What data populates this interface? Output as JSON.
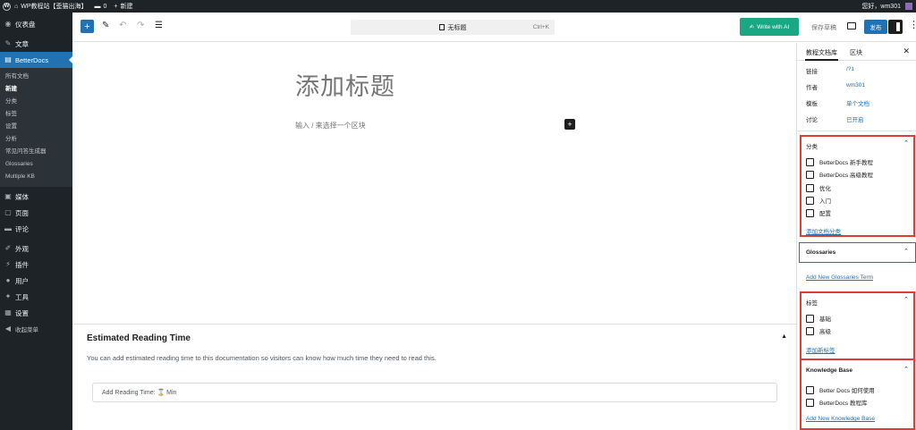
{
  "adminbar": {
    "site_name": "WP教程站【歪猫出海】",
    "comments_count": "0",
    "new_label": "新建",
    "greeting": "您好，wm301"
  },
  "sidebar": {
    "items": [
      {
        "label": "仪表盘",
        "icon": "dashboard-icon",
        "glyph": "◉"
      },
      {
        "label": "文章",
        "icon": "pin-icon",
        "glyph": "✎"
      },
      {
        "label": "BetterDocs",
        "icon": "docs-icon",
        "glyph": "▤"
      }
    ],
    "submenu": [
      "所有文档",
      "新建",
      "分类",
      "标签",
      "设置",
      "分析",
      "常见问答生成器",
      "Glossaries",
      "Multiple KB"
    ],
    "current_sub": "新建",
    "items_after": [
      {
        "label": "媒体",
        "icon": "media-icon",
        "glyph": "▣"
      },
      {
        "label": "页面",
        "icon": "page-icon",
        "glyph": "▢"
      },
      {
        "label": "评论",
        "icon": "comment-icon",
        "glyph": "▬"
      },
      {
        "label": "外观",
        "icon": "brush-icon",
        "glyph": "✐"
      },
      {
        "label": "插件",
        "icon": "plugin-icon",
        "glyph": "⚡"
      },
      {
        "label": "用户",
        "icon": "user-icon",
        "glyph": "●"
      },
      {
        "label": "工具",
        "icon": "wrench-icon",
        "glyph": "✦"
      },
      {
        "label": "设置",
        "icon": "settings-icon",
        "glyph": "▦"
      },
      {
        "label": "收起菜单",
        "icon": "collapse-icon",
        "glyph": "◀"
      }
    ]
  },
  "toolbar": {
    "doc_title": "无标题",
    "shortcut": "Ctrl+K",
    "write_ai": "Write with AI",
    "save_draft": "保存草稿",
    "publish": "发布"
  },
  "canvas": {
    "title_placeholder": "添加标题",
    "paragraph_placeholder": "输入 / 来选择一个区块"
  },
  "metabox": {
    "title": "Estimated Reading Time",
    "description": "You can add estimated reading time to this documentation so visitors can know how much time they need to read this.",
    "input_placeholder": "Add Reading Time: ⌛ Min"
  },
  "panel": {
    "tabs": [
      "教程文档库",
      "区块"
    ],
    "meta": [
      {
        "label": "链接",
        "value": "/?1"
      },
      {
        "label": "作者",
        "value": "wm301"
      },
      {
        "label": "模板",
        "value": "单个文档"
      },
      {
        "label": "讨论",
        "value": "已开启"
      }
    ],
    "categories": {
      "title": "分类",
      "items": [
        "BetterDocs 新手教程",
        "BetterDocs 高级教程",
        "优化",
        "入门",
        "配置"
      ],
      "add_link": "添加文档分类"
    },
    "glossaries": {
      "title": "Glossaries",
      "add_link": "Add New Glossaries Term"
    },
    "tags": {
      "title": "标签",
      "items": [
        "基础",
        "高级"
      ],
      "add_link": "添加新标签"
    },
    "kb": {
      "title": "Knowledge Base",
      "items": [
        "Better Docs 如何使用",
        "BetterDocs 教程库"
      ],
      "add_link": "Add New Knowledge Base"
    }
  }
}
